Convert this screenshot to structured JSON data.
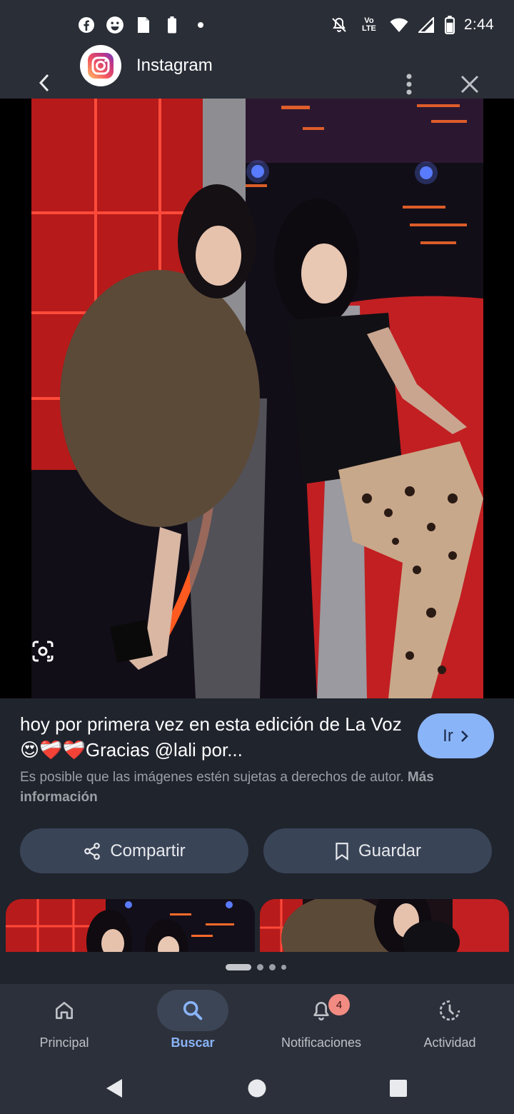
{
  "status_bar": {
    "time": "2:44",
    "left_icons": [
      "facebook-icon",
      "smiley-icon",
      "document-icon",
      "battery-saver-icon",
      "dot-icon"
    ],
    "right_icons": [
      "mute-icon",
      "volte-icon",
      "wifi-icon",
      "signal-icon",
      "battery-icon"
    ],
    "volte_text": "Vo LTE"
  },
  "app_bar": {
    "source_name": "Instagram",
    "source_icon": "instagram-icon"
  },
  "image": {
    "description_icon": "google-lens-icon"
  },
  "result": {
    "caption": "hoy por primera vez en esta edición de La Voz😍❤️‍🩹❤️‍🩹Gracias @lali por...",
    "go_label": "Ir",
    "copyright_text": "Es posible que las imágenes estén sujetas a derechos de autor.",
    "more_info_label": "Más información"
  },
  "actions": {
    "share_label": "Compartir",
    "save_label": "Guardar"
  },
  "pager": {
    "total": 4,
    "active": 1
  },
  "bottom_nav": {
    "items": [
      {
        "label": "Principal",
        "icon": "home-icon",
        "active": false
      },
      {
        "label": "Buscar",
        "icon": "search-icon",
        "active": true
      },
      {
        "label": "Notificaciones",
        "icon": "bell-icon",
        "active": false,
        "badge": "4"
      },
      {
        "label": "Actividad",
        "icon": "activity-icon",
        "active": false
      }
    ]
  },
  "colors": {
    "accent": "#8ab4f8",
    "background": "#20242d",
    "button_bg": "#394457",
    "badge": "#f28b82"
  }
}
